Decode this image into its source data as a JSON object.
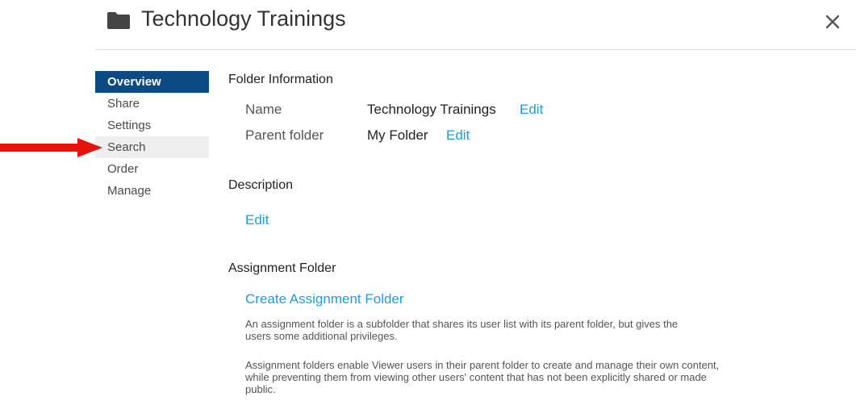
{
  "header": {
    "title": "Technology Trainings",
    "folder_icon": "folder-icon",
    "close_icon": "close-icon"
  },
  "sidebar": {
    "items": [
      {
        "label": "Overview",
        "state": "active"
      },
      {
        "label": "Share",
        "state": "normal"
      },
      {
        "label": "Settings",
        "state": "normal"
      },
      {
        "label": "Search",
        "state": "hover"
      },
      {
        "label": "Order",
        "state": "normal"
      },
      {
        "label": "Manage",
        "state": "normal"
      }
    ]
  },
  "annotation": {
    "arrow_color": "#e8120c",
    "arrow_icon": "arrow-right-icon"
  },
  "folder_info": {
    "heading": "Folder Information",
    "name_label": "Name",
    "name_value": "Technology Trainings",
    "name_edit": "Edit",
    "parent_label": "Parent folder",
    "parent_value": "My Folder",
    "parent_edit": "Edit"
  },
  "description": {
    "heading": "Description",
    "edit": "Edit"
  },
  "assignment": {
    "heading": "Assignment Folder",
    "create_link": "Create Assignment Folder",
    "para1": "An assignment folder is a subfolder that shares its user list with its parent folder, but gives the users some additional privileges.",
    "para2": "Assignment folders enable Viewer users in their parent folder to create and manage their own content, while preventing them from viewing other users' content that has not been explicitly shared or made public."
  },
  "colors": {
    "accent_active": "#0b4a83",
    "link": "#1c9fd6",
    "hover_bg": "#efefef"
  }
}
